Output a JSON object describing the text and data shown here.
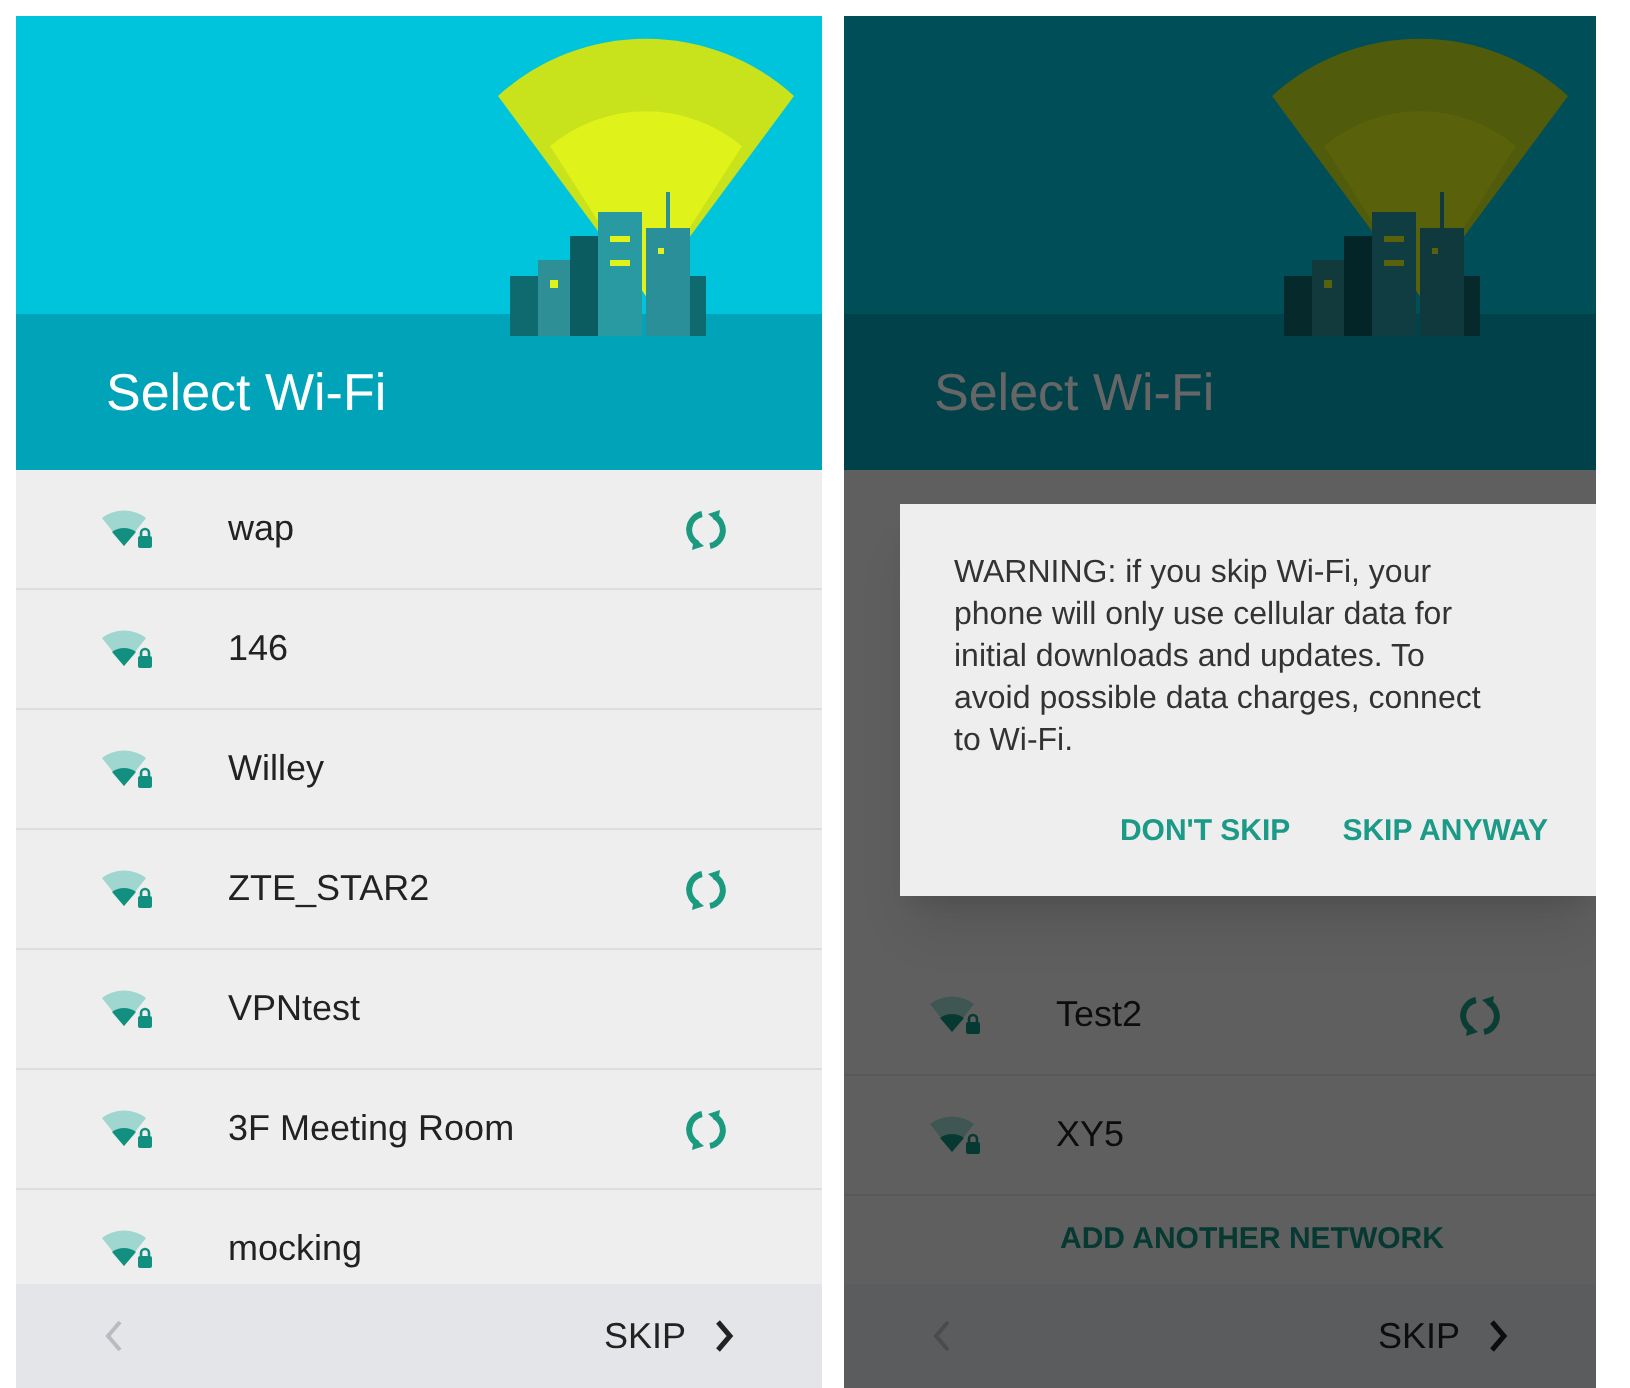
{
  "screens": [
    {
      "title": "Select Wi-Fi",
      "dimmed": false,
      "networks": [
        {
          "name": "wap",
          "sync_icon": true
        },
        {
          "name": "146",
          "sync_icon": false
        },
        {
          "name": "Willey",
          "sync_icon": false
        },
        {
          "name": "ZTE_STAR2",
          "sync_icon": true
        },
        {
          "name": "VPNtest",
          "sync_icon": false
        },
        {
          "name": "3F Meeting Room",
          "sync_icon": true
        },
        {
          "name": "mocking",
          "sync_icon": false
        }
      ],
      "footer": {
        "skip": "SKIP",
        "back_disabled": true
      }
    },
    {
      "title": "Select Wi-Fi",
      "dimmed": true,
      "networks": [
        {
          "name": "Test2",
          "sync_icon": true
        },
        {
          "name": "XY5",
          "sync_icon": false
        }
      ],
      "add_network": "ADD ANOTHER NETWORK",
      "footer": {
        "skip": "SKIP",
        "back_disabled": true
      },
      "dialog": {
        "message": "WARNING: if you skip Wi-Fi, your phone will only use cellular data for initial downloads and updates. To avoid possible data charges, connect to Wi-Fi.",
        "buttons": [
          "DON'T SKIP",
          "SKIP ANYWAY"
        ]
      }
    }
  ]
}
